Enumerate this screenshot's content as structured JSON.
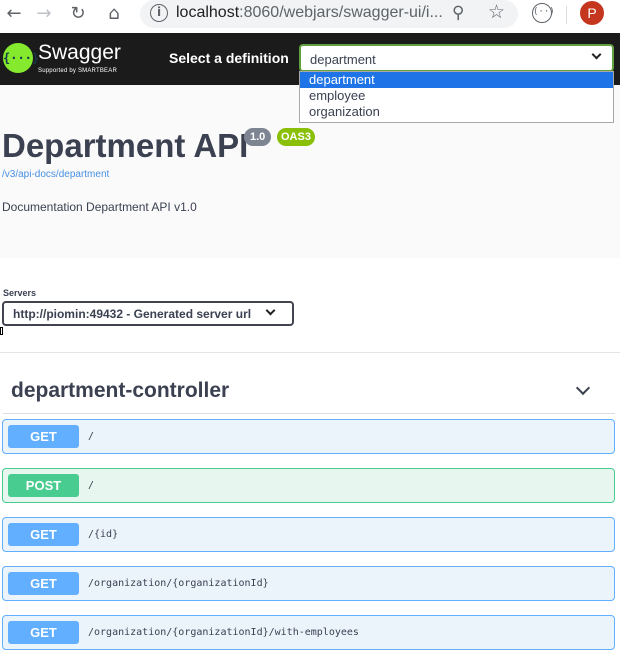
{
  "browser": {
    "url_host": "localhost",
    "url_rest": ":8060/webjars/swagger-ui/i...",
    "profile_initial": "P",
    "extension_glyph": "(··)"
  },
  "topbar": {
    "logo_glyph": "{···}",
    "logo_name": "Swagger",
    "logo_tagline": "Supported by SMARTBEAR",
    "definition_label": "Select a definition",
    "definition_selected": "department",
    "definition_options": [
      "department",
      "employee",
      "organization"
    ]
  },
  "info": {
    "title": "Department API",
    "version": "1.0",
    "oas_badge": "OAS3",
    "spec_link": "/v3/api-docs/department",
    "description": "Documentation Department API v1.0"
  },
  "servers": {
    "label": "Servers",
    "selected": "http://piomin:49432 - Generated server url"
  },
  "tag": {
    "name": "department-controller",
    "operations": [
      {
        "method": "GET",
        "path": "/"
      },
      {
        "method": "POST",
        "path": "/"
      },
      {
        "method": "GET",
        "path": "/{id}"
      },
      {
        "method": "GET",
        "path": "/organization/{organizationId}"
      },
      {
        "method": "GET",
        "path": "/organization/{organizationId}/with-employees"
      }
    ]
  },
  "colors": {
    "get": "#61affe",
    "post": "#49cc90",
    "topbar": "#1b1b1b",
    "logo": "#85ea2d",
    "selected_option": "#1e74e6"
  }
}
